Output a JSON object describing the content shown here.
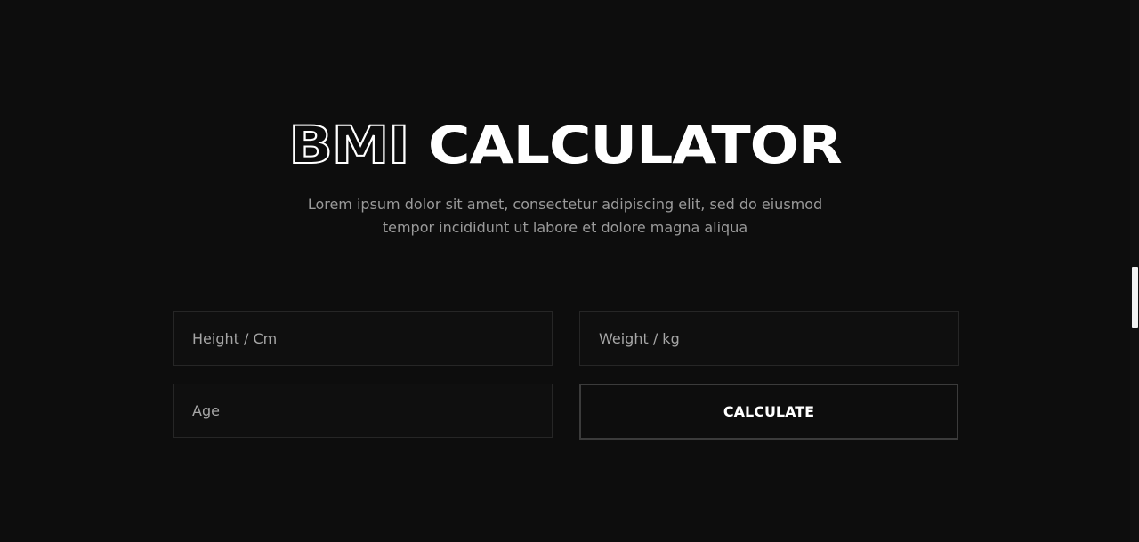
{
  "hero": {
    "title_outline": "BMI",
    "title_solid": "CALCULATOR",
    "description": "Lorem ipsum dolor sit amet, consectetur adipiscing elit, sed do eiusmod tempor incididunt ut labore et dolore magna aliqua"
  },
  "form": {
    "height": {
      "placeholder": "Height / Cm",
      "value": ""
    },
    "weight": {
      "placeholder": "Weight / kg",
      "value": ""
    },
    "age": {
      "placeholder": "Age",
      "value": ""
    },
    "submit_label": "CALCULATE"
  },
  "colors": {
    "background": "#0d0d0d",
    "field_border": "#262626",
    "button_border": "#3b3b3b",
    "text_primary": "#ffffff",
    "text_muted": "#9a9a9a"
  }
}
